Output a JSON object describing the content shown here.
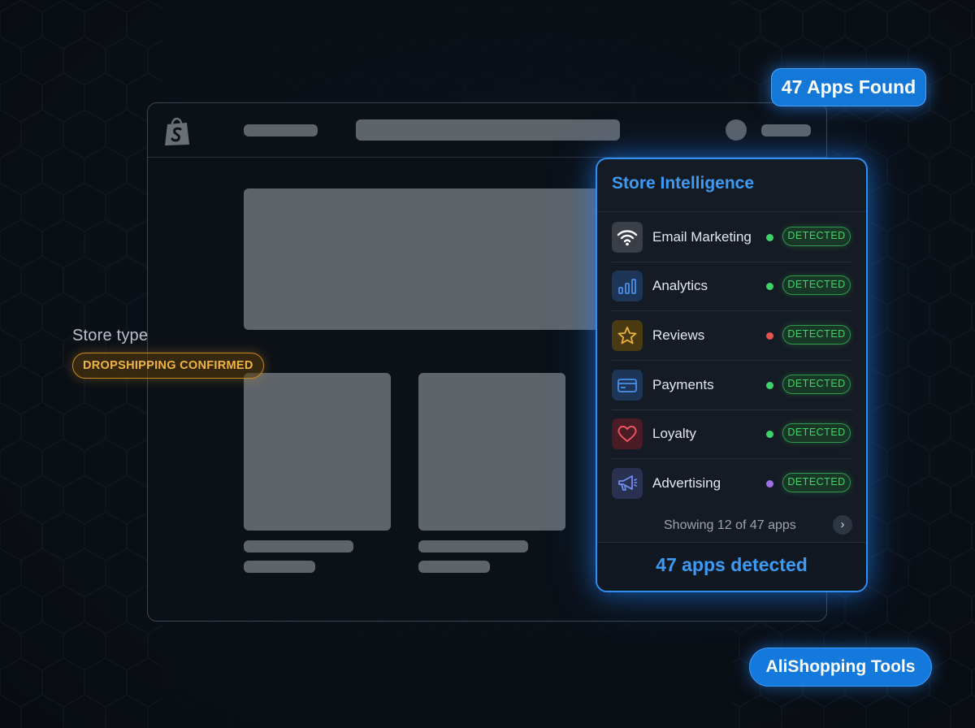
{
  "badges": {
    "apps_found": "47 Apps Found",
    "brand": "AliShopping Tools"
  },
  "store": {
    "type_label": "Store type",
    "type_value": "DROPSHIPPING CONFIRMED"
  },
  "panel": {
    "title": "Store Intelligence",
    "apps": [
      {
        "name": "Email Marketing",
        "icon": "wifi-icon",
        "dot_color": "#3fd26a",
        "status": "DETECTED"
      },
      {
        "name": "Analytics",
        "icon": "bar-chart-icon",
        "dot_color": "#3fd26a",
        "status": "DETECTED"
      },
      {
        "name": "Reviews",
        "icon": "star-icon",
        "dot_color": "#e5534b",
        "status": "DETECTED"
      },
      {
        "name": "Payments",
        "icon": "credit-card-icon",
        "dot_color": "#3fd26a",
        "status": "DETECTED"
      },
      {
        "name": "Loyalty",
        "icon": "heart-icon",
        "dot_color": "#3fd26a",
        "status": "DETECTED"
      },
      {
        "name": "Advertising",
        "icon": "megaphone-icon",
        "dot_color": "#a06ee8",
        "status": "DETECTED"
      }
    ],
    "showing": "Showing 12 of 47 apps",
    "footer": "47 apps detected"
  },
  "colors": {
    "accent": "#2f8ef0",
    "detected": "#47d16a",
    "warning": "#f1b444"
  }
}
